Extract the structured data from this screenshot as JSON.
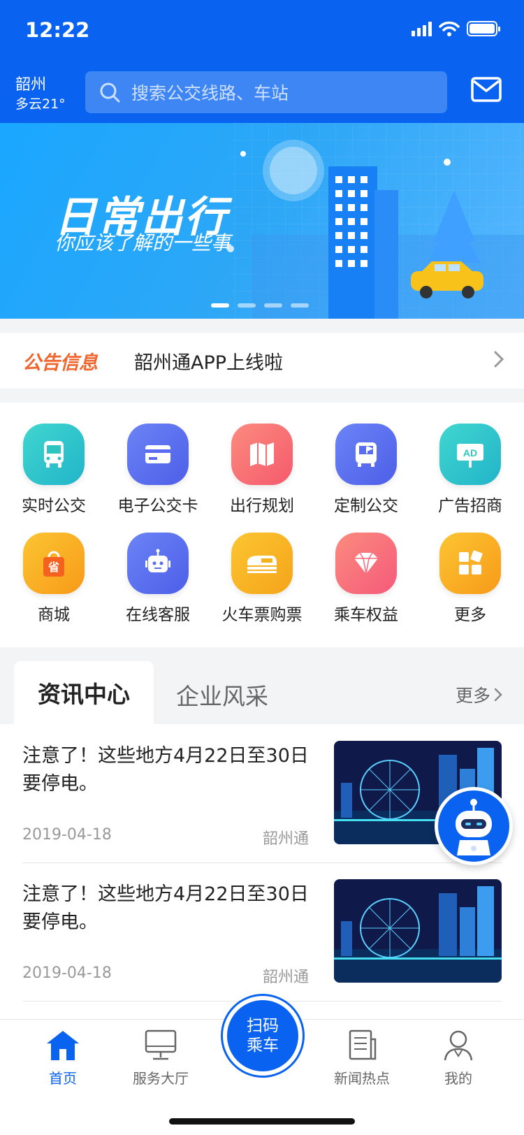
{
  "status": {
    "time": "12:22"
  },
  "header": {
    "city": "韶州",
    "weather": "多云21°",
    "search_placeholder": "搜索公交线路、车站"
  },
  "banner": {
    "title": "日常出行",
    "subtitle": "你应该了解的一些事",
    "slides": 4,
    "active_slide": 1
  },
  "notice": {
    "tag": "公告信息",
    "text": "韶州通APP上线啦"
  },
  "services": [
    {
      "label": "实时公交",
      "icon": "bus-icon",
      "color": "#2ec5c1"
    },
    {
      "label": "电子公交卡",
      "icon": "card-icon",
      "color": "#5a6cf0"
    },
    {
      "label": "出行规划",
      "icon": "map-icon",
      "color": "#f76b6b"
    },
    {
      "label": "定制公交",
      "icon": "custom-bus-icon",
      "color": "#5a6cf0"
    },
    {
      "label": "广告招商",
      "icon": "ad-icon",
      "color": "#2ec5c1"
    },
    {
      "label": "商城",
      "icon": "shopping-bag-icon",
      "color": "#f8a41c"
    },
    {
      "label": "在线客服",
      "icon": "robot-icon",
      "color": "#5a6cf0"
    },
    {
      "label": "火车票购票",
      "icon": "train-icon",
      "color": "#f5b21a"
    },
    {
      "label": "乘车权益",
      "icon": "diamond-icon",
      "color": "#f7677a"
    },
    {
      "label": "更多",
      "icon": "grid-icon",
      "color": "#f8a41c"
    }
  ],
  "tabs": {
    "active": "资讯中心",
    "other": "企业风采",
    "more": "更多"
  },
  "news": [
    {
      "title": "注意了！这些地方4月22日至30日要停电。",
      "date": "2019-04-18",
      "source": "韶州通"
    },
    {
      "title": "注意了！这些地方4月22日至30日要停电。",
      "date": "2019-04-18",
      "source": "韶州通"
    }
  ],
  "tabbar": {
    "home": "首页",
    "service": "服务大厅",
    "scan_line1": "扫码",
    "scan_line2": "乘车",
    "news": "新闻热点",
    "mine": "我的"
  },
  "colors": {
    "primary": "#0a63f0",
    "notice": "#f0662f"
  }
}
